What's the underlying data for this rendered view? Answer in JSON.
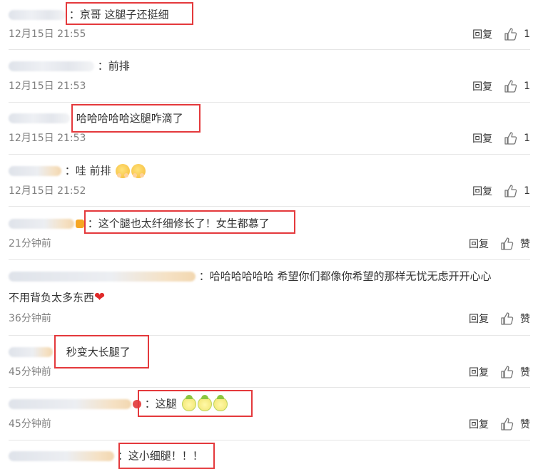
{
  "reply_label": "回复",
  "like_label": "赞",
  "comments": [
    {
      "content": "：京哥 这腿子还挺细",
      "time": "12月15日 21:55",
      "likes": "1"
    },
    {
      "content": "：前排",
      "time": "12月15日 21:53",
      "likes": "1"
    },
    {
      "content": "哈哈哈哈哈这腿咋滴了",
      "time": "12月15日 21:53",
      "likes": "1"
    },
    {
      "content": "：哇 前排",
      "time": "12月15日 21:52",
      "likes": "1"
    },
    {
      "content": "：这个腿也太纤细修长了！女生都慕了",
      "time": "21分钟前",
      "likes": "赞"
    },
    {
      "content": "：哈哈哈哈哈哈 希望你们都像你希望的那样无忧无虑开开心心",
      "content2": "不用背负太多东西",
      "time": "36分钟前",
      "likes": "赞"
    },
    {
      "content": "秒变大长腿了",
      "time": "45分钟前",
      "likes": "赞"
    },
    {
      "content": "：这腿",
      "time": "45分钟前",
      "likes": "赞"
    },
    {
      "content": "：这小细腿！！！"
    }
  ],
  "colors": {
    "highlight": "#e4393c",
    "timestamp": "#808080",
    "heart": "#e02a2a"
  }
}
